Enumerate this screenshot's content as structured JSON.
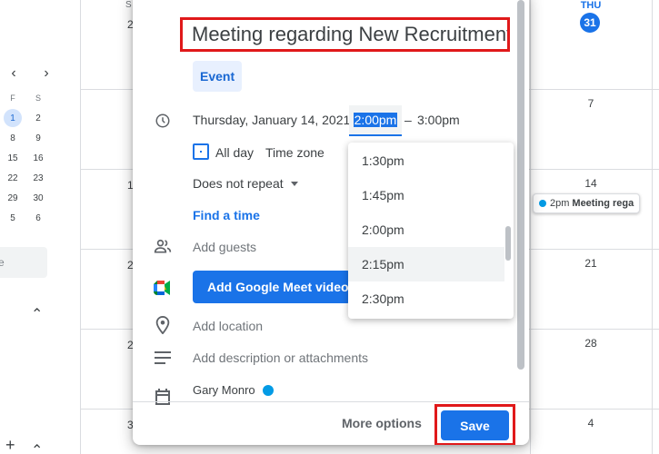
{
  "mini_calendar": {
    "nav_prev": "‹",
    "nav_next": "›",
    "day_headers": [
      "F",
      "S"
    ],
    "weeks": [
      [
        "1",
        "2"
      ],
      [
        "8",
        "9"
      ],
      [
        "15",
        "16"
      ],
      [
        "22",
        "23"
      ],
      [
        "29",
        "30"
      ],
      [
        "5",
        "6"
      ]
    ],
    "highlighted_day": "1",
    "search_people_placeholder": "e"
  },
  "calendar_grid": {
    "left_column_day_numbers": [
      "S",
      "2",
      "1",
      "2",
      "2",
      "3"
    ],
    "thursday_header": "THU",
    "thursday_dates": [
      "31",
      "7",
      "14",
      "21",
      "28",
      "4"
    ],
    "today_date": "31",
    "event_chip": {
      "time": "2pm",
      "title": "Meeting rega",
      "color": "#039be5"
    }
  },
  "dialog": {
    "title_value": "Meeting regarding New Recruitment",
    "event_type": "Event",
    "date": "Thursday, January 14, 2021",
    "start_time": "2:00pm",
    "dash": "–",
    "end_time": "3:00pm",
    "all_day_label": "All day",
    "time_zone_label": "Time zone",
    "repeat_value": "Does not repeat",
    "find_time_label": "Find a time",
    "add_guests_placeholder": "Add guests",
    "meet_button_label": "Add Google Meet video conferencing",
    "add_location_placeholder": "Add location",
    "add_description_placeholder": "Add description or attachments",
    "owner_name": "Gary Monro",
    "owner_color": "#039be5",
    "more_options_label": "More options",
    "save_label": "Save"
  },
  "time_dropdown": {
    "options": [
      "1:30pm",
      "1:45pm",
      "2:00pm",
      "2:15pm",
      "2:30pm"
    ],
    "hovered": "2:15pm"
  },
  "colors": {
    "accent": "#1a73e8",
    "highlight_outline": "#e0191a"
  }
}
